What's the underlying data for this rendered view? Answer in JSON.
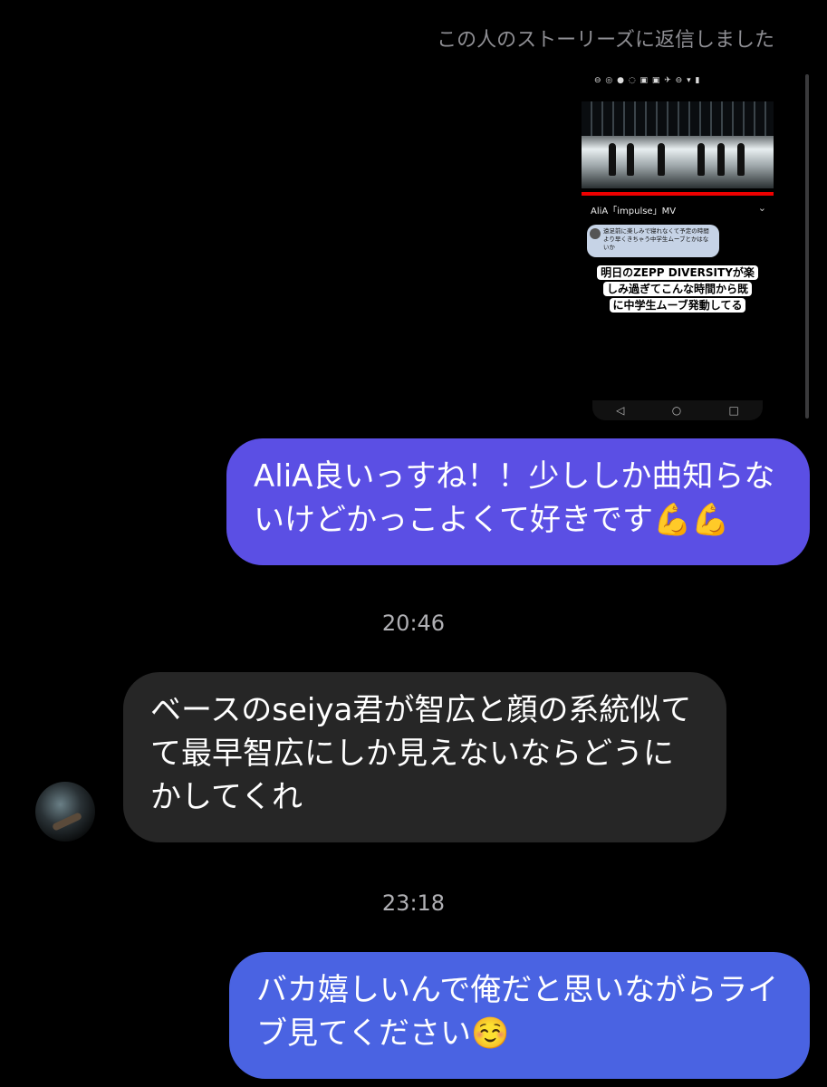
{
  "story_reply": {
    "caption": "この人のストーリーズに返信しました",
    "thumbnail": {
      "status_icons": "⊖ ◎ ● ◌ ▣ ▣ ✈ ⊖ ▾ ▮",
      "video_title": "AliA「impulse」MV",
      "chevron": "⌄",
      "mini_message": "遠足前に楽しみで寝れなくて予定の時間より早くきちゃう中学生ムーブとかはないか",
      "sticker_lines": [
        "明日のZEPP DIVERSITYが楽",
        "しみ過ぎてこんな時間から既",
        "に中学生ムーブ発動してる"
      ],
      "nav_icons": [
        "◁",
        "○",
        "□"
      ]
    }
  },
  "messages": [
    {
      "direction": "outgoing",
      "text": "AliA良いっすね！！少ししか曲知らないけどかっこよくて好きです💪💪"
    },
    {
      "type": "timestamp",
      "text": "20:46"
    },
    {
      "direction": "incoming",
      "text": "ベースのseiya君が智広と顔の系統似てて最早智広にしか見えないならどうにかしてくれ"
    },
    {
      "type": "timestamp",
      "text": "23:18"
    },
    {
      "direction": "outgoing",
      "text": "バカ嬉しいんで俺だと思いながらライブ見てください☺️"
    }
  ],
  "colors": {
    "background": "#000000",
    "outgoing_bubble_1": "#5b4fe4",
    "outgoing_bubble_2": "#4a63e2",
    "incoming_bubble": "#262626"
  },
  "avatar_icon": "user-avatar-icon"
}
